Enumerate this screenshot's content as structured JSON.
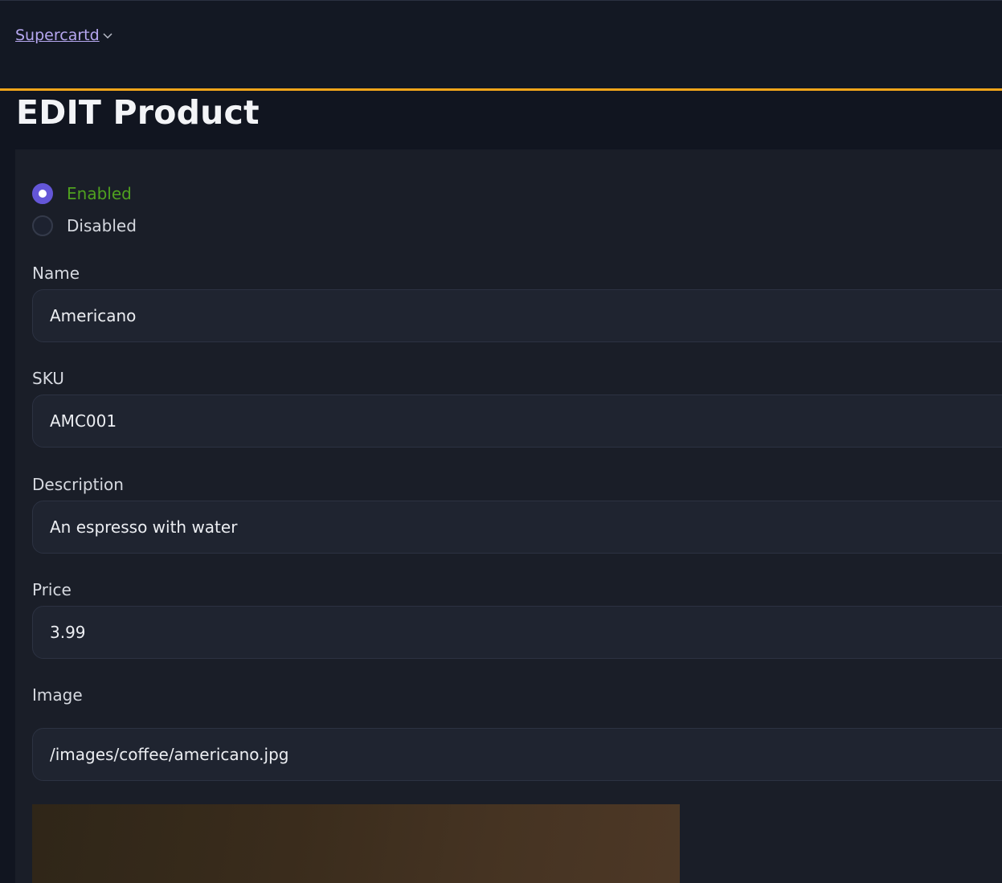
{
  "app": {
    "brand": "Supercartd"
  },
  "page": {
    "title": "EDIT Product"
  },
  "status": {
    "options": [
      {
        "label": "Enabled",
        "selected": true
      },
      {
        "label": "Disabled",
        "selected": false
      }
    ]
  },
  "fields": {
    "name": {
      "label": "Name",
      "value": "Americano"
    },
    "sku": {
      "label": "SKU",
      "value": "AMC001"
    },
    "description": {
      "label": "Description",
      "value": "An espresso with water"
    },
    "price": {
      "label": "Price",
      "value": "3.99"
    },
    "image": {
      "label": "Image",
      "value": "/images/coffee/americano.jpg"
    }
  },
  "colors": {
    "accent": "#f2a51a",
    "radio_checked": "#6456d8",
    "enabled_text": "#4fa11f",
    "brand_link": "#b6a7f0"
  },
  "icons": {
    "brand_dropdown": "chevron-down-icon"
  }
}
